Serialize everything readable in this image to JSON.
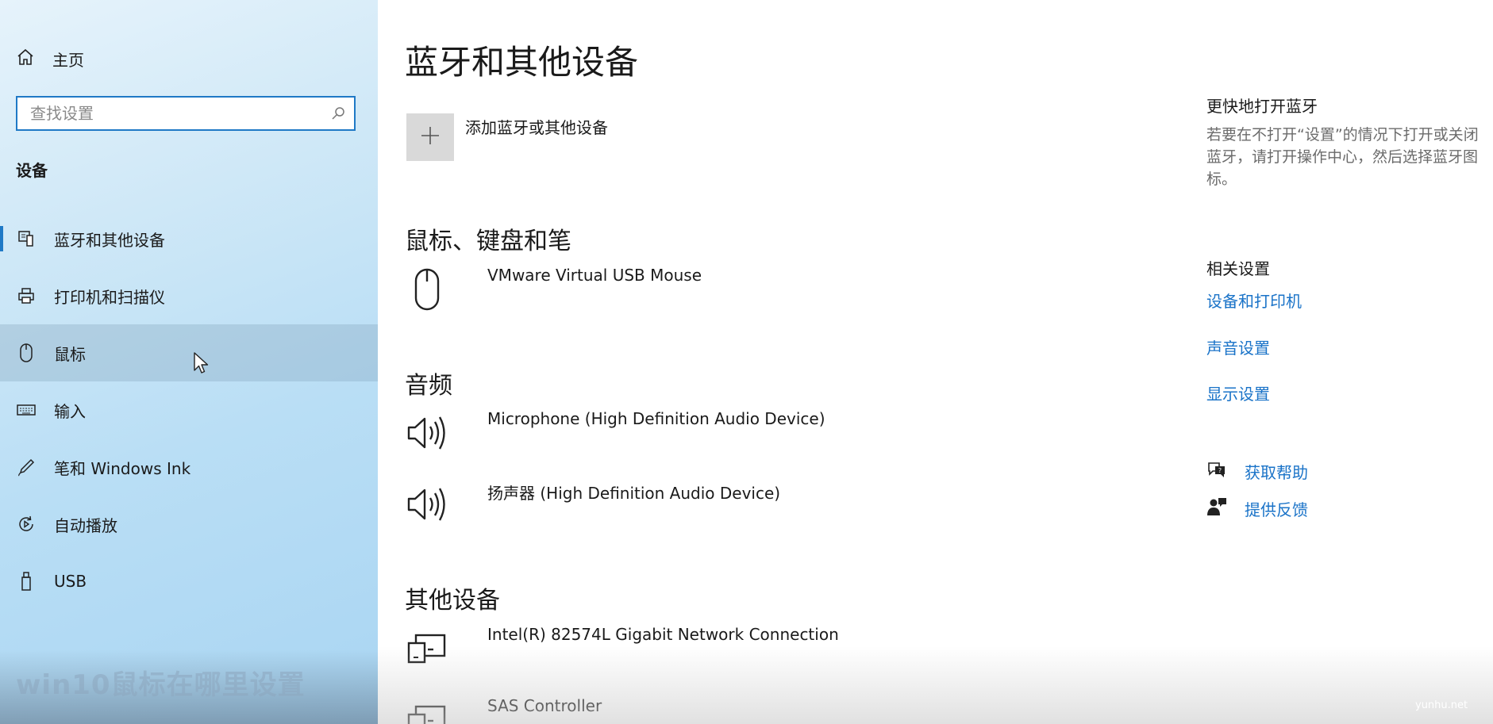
{
  "sidebar": {
    "home_label": "主页",
    "search_placeholder": "查找设置",
    "section_label": "设备",
    "items": [
      {
        "label": "蓝牙和其他设备",
        "icon": "bluetooth-devices-icon"
      },
      {
        "label": "打印机和扫描仪",
        "icon": "printer-icon"
      },
      {
        "label": "鼠标",
        "icon": "mouse-icon"
      },
      {
        "label": "输入",
        "icon": "keyboard-icon"
      },
      {
        "label": "笔和 Windows Ink",
        "icon": "pen-icon"
      },
      {
        "label": "自动播放",
        "icon": "autoplay-icon"
      },
      {
        "label": "USB",
        "icon": "usb-icon"
      }
    ],
    "overlay_text": "win10鼠标在哪里设置"
  },
  "main": {
    "title": "蓝牙和其他设备",
    "add_device_label": "添加蓝牙或其他设备",
    "groups": [
      {
        "heading": "鼠标、键盘和笔",
        "devices": [
          {
            "name": "VMware Virtual USB Mouse",
            "icon": "mouse-icon"
          }
        ]
      },
      {
        "heading": "音频",
        "devices": [
          {
            "name": "Microphone (High Definition Audio Device)",
            "icon": "speaker-icon"
          },
          {
            "name": "扬声器 (High Definition Audio Device)",
            "icon": "speaker-icon"
          }
        ]
      },
      {
        "heading": "其他设备",
        "devices": [
          {
            "name": "Intel(R) 82574L Gigabit Network Connection",
            "icon": "generic-device-icon"
          },
          {
            "name": "SAS Controller",
            "icon": "generic-device-icon"
          }
        ]
      }
    ]
  },
  "right_panel": {
    "quick_heading": "更快地打开蓝牙",
    "quick_desc": "若要在不打开“设置”的情况下打开或关闭蓝牙，请打开操作中心，然后选择蓝牙图标。",
    "related_heading": "相关设置",
    "links": [
      "设备和打印机",
      "声音设置",
      "显示设置"
    ],
    "help": {
      "get_help": "获取帮助",
      "feedback": "提供反馈"
    }
  },
  "watermark": "yunhu.net",
  "colors": {
    "accent": "#1f79c6",
    "link": "#1a73c8"
  }
}
